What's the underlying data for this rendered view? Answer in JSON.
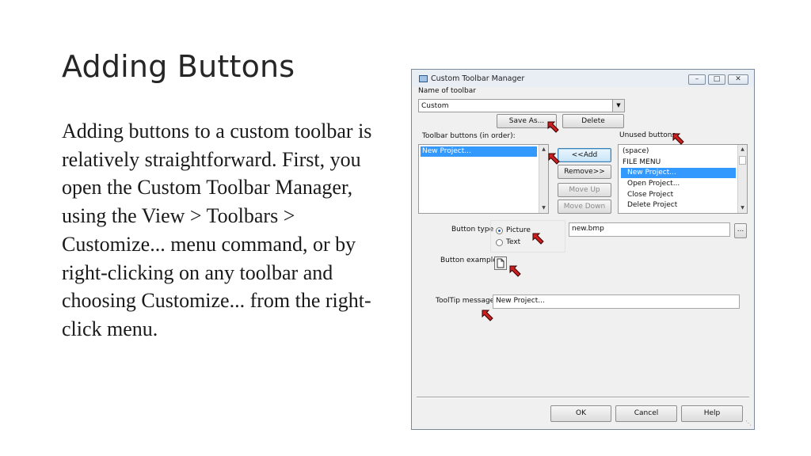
{
  "slide": {
    "title": "Adding Buttons",
    "body": "Adding buttons to a custom toolbar is relatively straightforward. First, you open the Custom Toolbar Manager, using the View > Toolbars > Customize... menu command, or by right-clicking on any toolbar and choosing Customize... from the right-click menu."
  },
  "dialog": {
    "title": "Custom Toolbar Manager",
    "name_of_toolbar_label": "Name of toolbar",
    "toolbar_name_value": "Custom",
    "save_as_label": "Save As...",
    "delete_label": "Delete",
    "toolbar_buttons_label": "Toolbar buttons (in order):",
    "unused_buttons_label": "Unused buttons:",
    "toolbar_buttons": [
      "New Project..."
    ],
    "unused_buttons": [
      "(space)",
      "FILE MENU",
      "New Project...",
      "Open Project...",
      "Close Project",
      "Delete Project"
    ],
    "unused_selected_index": 2,
    "add_label": "<<Add",
    "remove_label": "Remove>>",
    "move_up_label": "Move Up",
    "move_down_label": "Move Down",
    "button_type_label": "Button type",
    "picture_label": "Picture",
    "text_label": "Text",
    "button_type_selected": "Picture",
    "image_file_value": "new.bmp",
    "browse_label": "...",
    "button_example_label": "Button example",
    "tooltip_label": "ToolTip message:",
    "tooltip_value": "New Project...",
    "ok_label": "OK",
    "cancel_label": "Cancel",
    "help_label": "Help"
  },
  "colors": {
    "annotation_arrow": "#cc1f1f",
    "selection": "#3399ff"
  },
  "icons": [
    "toolbar-manager-icon",
    "minimize-icon",
    "maximize-icon",
    "close-icon",
    "dropdown-arrow-icon",
    "document-icon",
    "callout-arrow-icon",
    "resize-grip-icon"
  ]
}
